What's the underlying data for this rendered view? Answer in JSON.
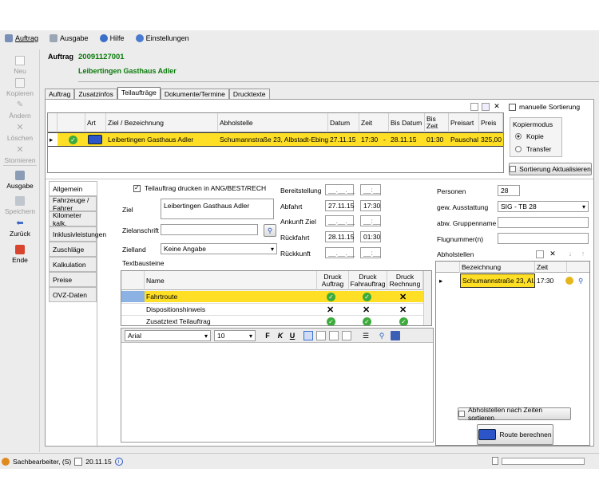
{
  "menu": [
    {
      "label": "Auftrag",
      "icon": "order-icon"
    },
    {
      "label": "Ausgabe",
      "icon": "print-icon"
    },
    {
      "label": "Hilfe",
      "icon": "help-icon"
    },
    {
      "label": "Einstellungen",
      "icon": "settings-icon"
    }
  ],
  "sidebar": {
    "neu": "Neu",
    "kopieren": "Kopieren",
    "aendern": "Ändern",
    "loeschen": "Löschen",
    "stornieren": "Stornieren",
    "ausgabe": "Ausgabe",
    "speichern": "Speichern",
    "zurueck": "Zurück",
    "ende": "Ende"
  },
  "header": {
    "label": "Auftrag",
    "number": "20091127001",
    "customer": "Leibertingen Gasthaus Adler"
  },
  "tabs": [
    "Auftrag",
    "Zusatzinfos",
    "Teilaufträge",
    "Dokumente/Termine",
    "Drucktexte"
  ],
  "subtasks": {
    "columns": [
      "Art",
      "Ziel / Bezeichnung",
      "Abholstelle",
      "Datum",
      "Zeit",
      "Bis Datum",
      "Bis Zeit",
      "Preisart",
      "Preis"
    ],
    "row": {
      "ziel": "Leibertingen Gasthaus Adler",
      "abholstelle": "Schumannstraße 23, Albstadt-Ebingen",
      "datum": "27.11.15",
      "zeit": "17:30",
      "sep": "-",
      "bis_datum": "28.11.15",
      "bis_zeit": "01:30",
      "preisart": "Pauschal",
      "preis": "325,00"
    }
  },
  "manual_sort": "manuelle Sortierung",
  "kopiermodus": {
    "title": "Kopiermodus",
    "kopie": "Kopie",
    "transfer": "Transfer"
  },
  "sort_button": "Sortierung Aktualisieren",
  "left_tabs": [
    "Allgemein",
    "Fahrzeuge / Fahrer",
    "Kilometer kalk.",
    "Inklusivleistungen",
    "Zuschläge",
    "Kalkulation",
    "Preise",
    "OVZ-Daten"
  ],
  "form": {
    "print_check": "Teilauftrag drucken in ANG/BEST/RECH",
    "ziel_label": "Ziel",
    "ziel_value": "Leibertingen Gasthaus Adler",
    "zielanschrift_label": "Zielanschrift",
    "zielland_label": "Zielland",
    "zielland_value": "Keine Angabe",
    "textbausteine": "Textbausteine",
    "bereitstellung": "Bereitstellung",
    "abfahrt": "Abfahrt",
    "ankunft_ziel": "Ankunft Ziel",
    "rueckfahrt": "Rückfahrt",
    "rueckkunft": "Rückkunft",
    "empty_date": "__.__.__",
    "empty_time": "__:__",
    "abfahrt_date": "27.11.15",
    "abfahrt_time": "17:30",
    "rueck_date": "28.11.15",
    "rueck_time": "01:30",
    "personen_label": "Personen",
    "personen_value": "28",
    "ausstattung_label": "gew. Ausstattung",
    "ausstattung_value": "SIG - TB 28",
    "gruppenname_label": "abw. Gruppenname",
    "flugnummer_label": "Flugnummer(n)",
    "abholstellen_label": "Abholstellen"
  },
  "textblocks": {
    "columns": [
      "Name",
      "Druck Auftrag",
      "Druck Fahrauftrag",
      "Druck Rechnung"
    ],
    "rows": [
      {
        "name": "Fahrtroute",
        "a": "ok",
        "f": "ok",
        "r": "x"
      },
      {
        "name": "Dispositionshinweis",
        "a": "x",
        "f": "x",
        "r": "x"
      },
      {
        "name": "Zusatztext Teilauftrag",
        "a": "ok",
        "f": "ok",
        "r": "ok"
      }
    ]
  },
  "editor": {
    "font": "Arial",
    "size": "10",
    "bold": "F",
    "italic": "K",
    "underline": "U"
  },
  "pickups": {
    "columns": [
      "Bezeichnung",
      "Zeit"
    ],
    "row": {
      "name": "Schumannstraße 23, Al...",
      "zeit": "17:30"
    }
  },
  "sort_pickups_button": "Abholstellen nach Zeiten sortieren",
  "route_button": "Route berechnen",
  "status": {
    "user": "Sachbearbeiter, (S)",
    "date": "20.11.15"
  }
}
